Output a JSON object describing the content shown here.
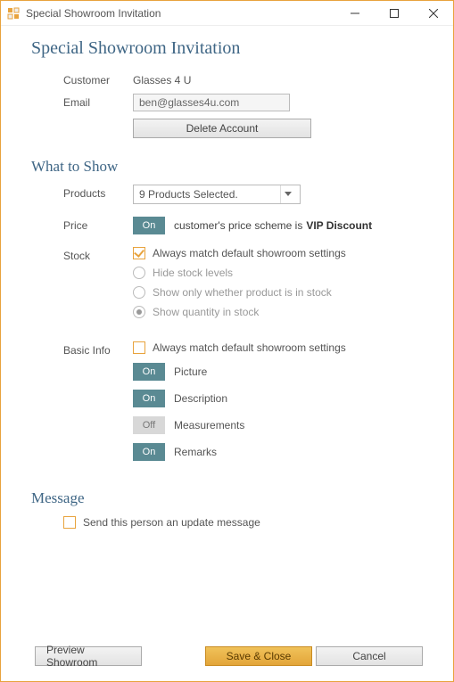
{
  "window": {
    "title": "Special Showroom Invitation",
    "min_icon": "minimize",
    "max_icon": "maximize",
    "close_icon": "close"
  },
  "page": {
    "title": "Special Showroom Invitation"
  },
  "customer": {
    "label": "Customer",
    "value": "Glasses 4 U"
  },
  "email": {
    "label": "Email",
    "value": "ben@glasses4u.com"
  },
  "delete_account_label": "Delete Account",
  "sections": {
    "what_to_show": "What to Show",
    "message": "Message"
  },
  "products": {
    "label": "Products",
    "selected_text": "9 Products Selected."
  },
  "price": {
    "label": "Price",
    "toggle": "On",
    "text_before": "customer's price scheme is ",
    "scheme": "VIP Discount"
  },
  "stock": {
    "label": "Stock",
    "always_match": "Always match default showroom settings",
    "options": {
      "hide": "Hide stock levels",
      "in_stock_only": "Show only whether product is in stock",
      "quantity": "Show quantity in stock"
    }
  },
  "basic_info": {
    "label": "Basic Info",
    "always_match": "Always match default showroom settings",
    "picture": {
      "toggle": "On",
      "label": "Picture"
    },
    "description": {
      "toggle": "On",
      "label": "Description"
    },
    "measurements": {
      "toggle": "Off",
      "label": "Measurements"
    },
    "remarks": {
      "toggle": "On",
      "label": "Remarks"
    }
  },
  "message": {
    "send_update": "Send this person an update message"
  },
  "footer": {
    "preview": "Preview Showroom",
    "save": "Save & Close",
    "cancel": "Cancel"
  }
}
